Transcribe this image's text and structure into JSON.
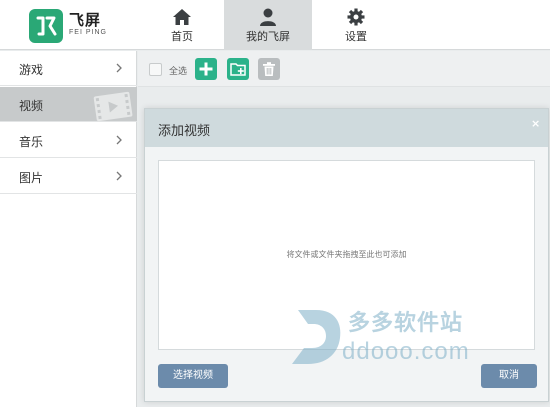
{
  "app": {
    "logo_cn": "飞屏",
    "logo_en": "FEI PING"
  },
  "nav": {
    "tabs": [
      {
        "label": "首页",
        "icon": "home-icon",
        "active": false
      },
      {
        "label": "我的飞屏",
        "icon": "user-icon",
        "active": true
      },
      {
        "label": "设置",
        "icon": "gear-icon",
        "active": false
      }
    ]
  },
  "sidebar": {
    "items": [
      {
        "label": "游戏",
        "active": false
      },
      {
        "label": "视频",
        "active": true
      },
      {
        "label": "音乐",
        "active": false
      },
      {
        "label": "图片",
        "active": false
      }
    ]
  },
  "toolbar": {
    "select_all_label": "全选",
    "buttons": [
      "add-icon",
      "add-folder-icon",
      "trash-icon"
    ]
  },
  "dialog": {
    "title": "添加视频",
    "close_symbol": "×",
    "drop_hint": "将文件或文件夹拖拽至此也可添加",
    "choose_label": "选择视频",
    "cancel_label": "取消"
  },
  "watermark": {
    "cn": "多多软件站",
    "en": "ddooo.com"
  },
  "colors": {
    "accent_green": "#2bb28a",
    "button_blue": "#6c8bab",
    "dialog_header": "#cfdadd"
  }
}
